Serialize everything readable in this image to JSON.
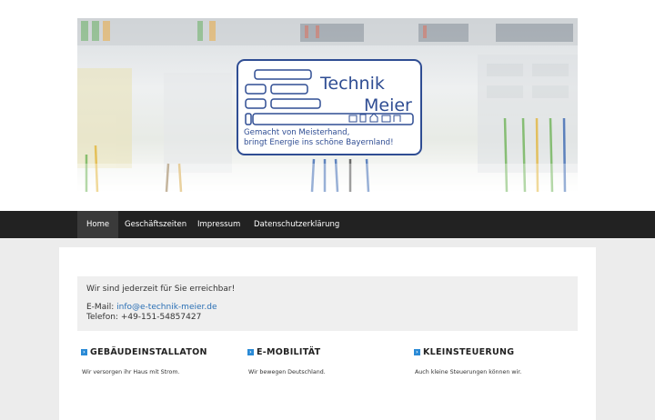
{
  "banner": {
    "logo_line1": "Technik",
    "logo_line2": "Meier",
    "tagline_line1": "Gemacht von Meisterhand,",
    "tagline_line2": "bringt Energie ins schöne Bayernland!"
  },
  "nav": {
    "items": [
      {
        "label": "Home",
        "active": true
      },
      {
        "label": "Geschäftszeiten",
        "active": false
      },
      {
        "label": "Impressum",
        "active": false
      },
      {
        "label": "Datenschutzerklärung",
        "active": false
      }
    ]
  },
  "notice": {
    "heading": "Wir sind jederzeit für Sie erreichbar!",
    "email_label": "E-Mail:",
    "email": "info@e-technik-meier.de",
    "phone": "Telefon: +49-151-54857427"
  },
  "features": [
    {
      "title": "GEBÄUDEINSTALLATON",
      "text": "Wir versorgen ihr Haus mit Strom."
    },
    {
      "title": "E-MOBILITÄT",
      "text": "Wir bewegen Deutschland."
    },
    {
      "title": "KLEINSTEUERUNG",
      "text": "Auch kleine Steuerungen können wir."
    }
  ],
  "colors": {
    "navbar": "#222222",
    "brand_blue": "#2f4d93",
    "link": "#2a6fb5",
    "bullet": "#2a8ad6"
  }
}
